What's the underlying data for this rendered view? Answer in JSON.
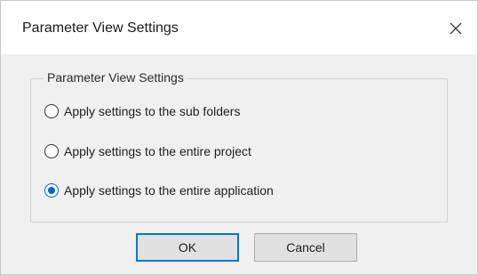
{
  "window": {
    "title": "Parameter View Settings",
    "close_icon": "close-icon"
  },
  "group": {
    "legend": "Parameter View Settings",
    "options": [
      {
        "label": "Apply settings to the sub folders",
        "selected": false
      },
      {
        "label": "Apply settings to the entire project",
        "selected": false
      },
      {
        "label": "Apply settings to the entire application",
        "selected": true
      }
    ]
  },
  "buttons": {
    "ok_label": "OK",
    "cancel_label": "Cancel"
  },
  "colors": {
    "accent": "#0078d7",
    "dialog_bg": "#f0f0f0",
    "title_bg": "#ffffff"
  }
}
